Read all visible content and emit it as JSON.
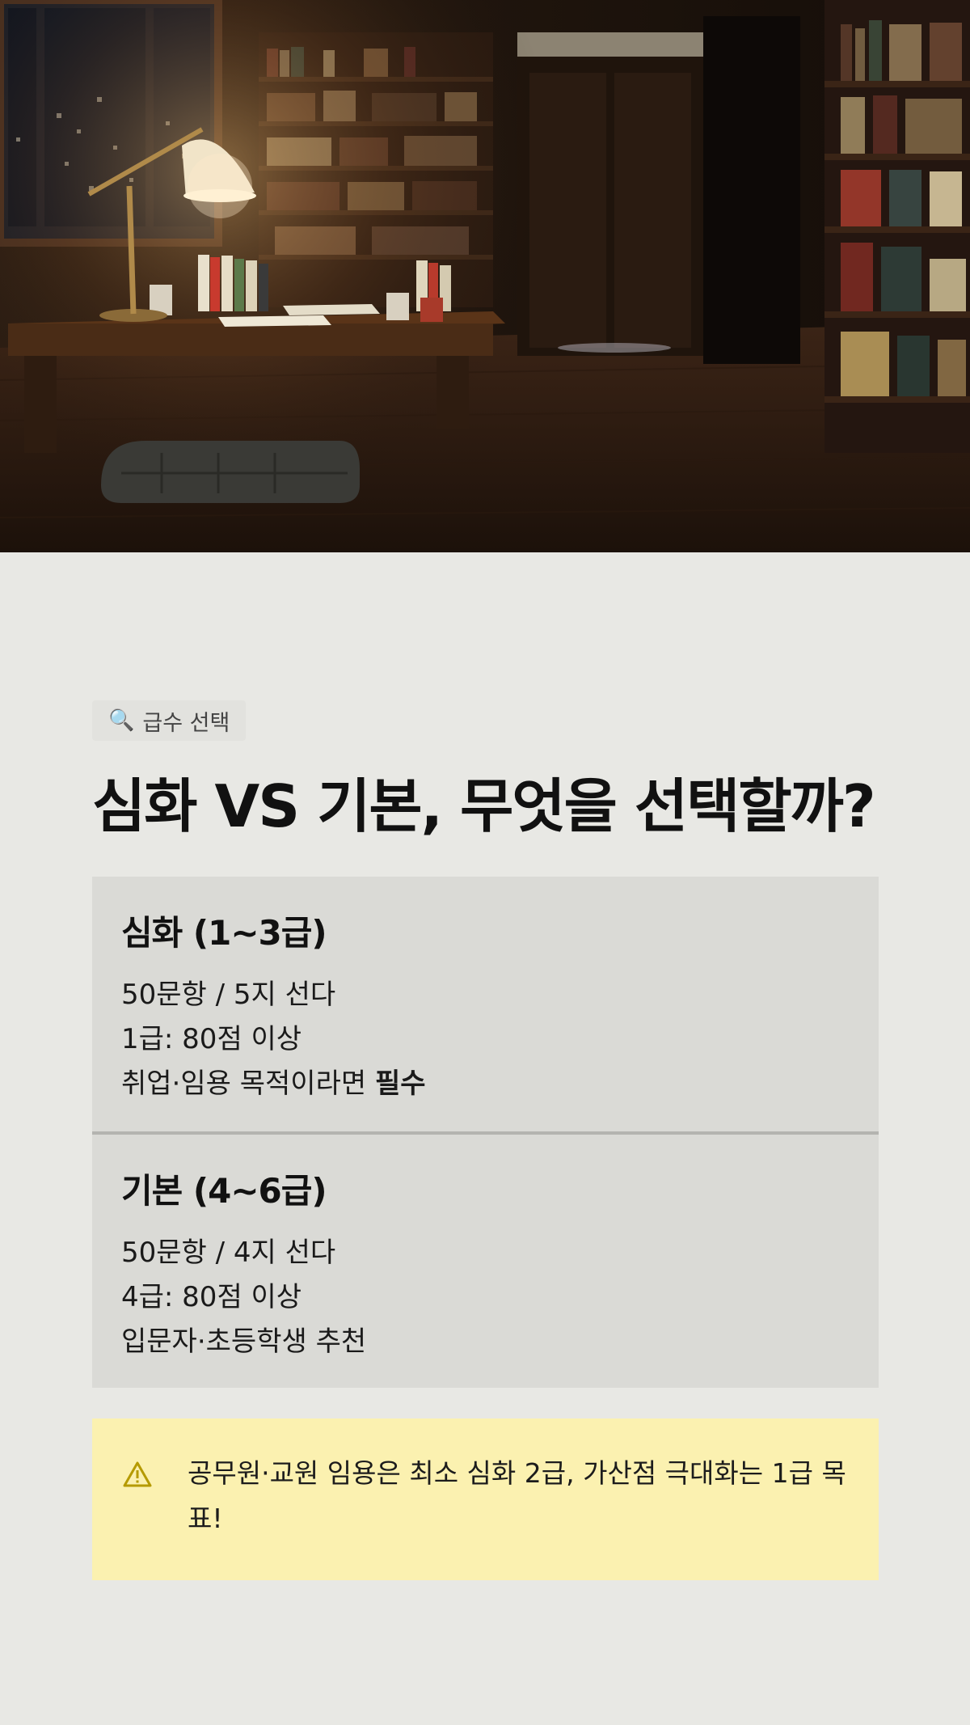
{
  "hero": {
    "image_description_icon": "study-room-illustration"
  },
  "tag": {
    "icon": "search-icon",
    "label": "급수 선택"
  },
  "title": "심화 VS 기본, 무엇을 선택할까?",
  "cards": [
    {
      "title": "심화 (1~3급)",
      "line1": "50문항 / 5지 선다",
      "line2": "1급: 80점 이상",
      "line3_prefix": "취업·임용 목적이라면 ",
      "line3_bold": "필수"
    },
    {
      "title": "기본 (4~6급)",
      "line1": "50문항 / 4지 선다",
      "line2": "4급: 80점 이상",
      "line3": "입문자·초등학생 추천"
    }
  ],
  "notice": {
    "icon": "warning-icon",
    "text": "공무원·교원 임용은 최소 심화 2급, 가산점 극대화는 1급 목표!"
  },
  "colors": {
    "page_bg": "#e8e8e4",
    "card_bg": "#dadad6",
    "notice_bg": "#fbf1b0",
    "warning_accent": "#b59a00"
  }
}
